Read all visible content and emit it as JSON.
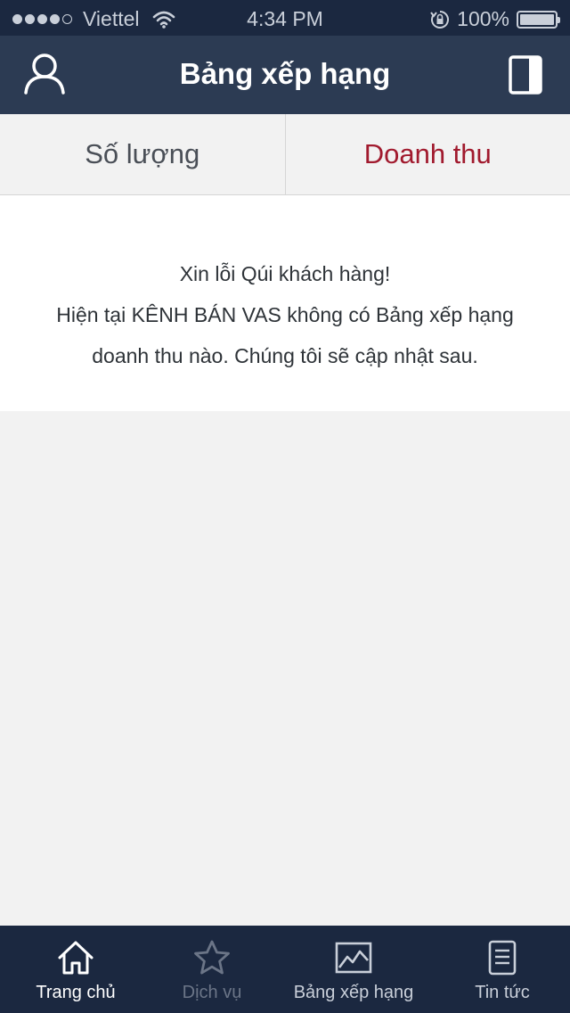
{
  "status_bar": {
    "carrier": "Viettel",
    "time": "4:34 PM",
    "battery": "100%",
    "signal_bars": 4
  },
  "nav": {
    "title": "Bảng xếp hạng"
  },
  "tabs": [
    {
      "label": "Số lượng",
      "active": false
    },
    {
      "label": "Doanh thu",
      "active": true
    }
  ],
  "message": {
    "line1": "Xin lỗi Qúi khách hàng!",
    "line2": "Hiện tại KÊNH BÁN VAS không có Bảng xếp hạng",
    "line3": "doanh thu nào. Chúng tôi sẽ cập nhật sau."
  },
  "tab_bar": {
    "items": [
      {
        "label": "Trang chủ",
        "icon": "home-icon",
        "state": "active"
      },
      {
        "label": "Dịch vụ",
        "icon": "star-icon",
        "state": "disabled"
      },
      {
        "label": "Bảng xếp hạng",
        "icon": "chart-icon",
        "state": "normal"
      },
      {
        "label": "Tin tức",
        "icon": "news-icon",
        "state": "normal"
      }
    ]
  },
  "colors": {
    "status_bar_bg": "#1b2840",
    "nav_bg": "#2c3b53",
    "accent": "#a11a2e",
    "tab_bar_bg": "#1b2840"
  }
}
